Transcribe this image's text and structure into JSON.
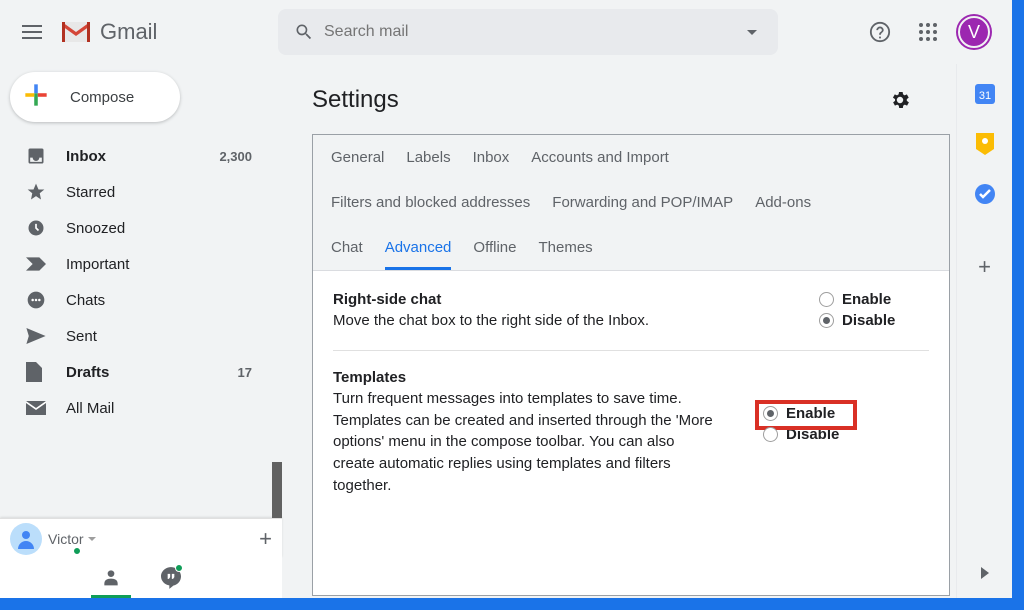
{
  "header": {
    "app_name": "Gmail",
    "search_placeholder": "Search mail",
    "avatar_letter": "V"
  },
  "compose": {
    "label": "Compose"
  },
  "sidebar": {
    "items": [
      {
        "label": "Inbox",
        "count": "2,300",
        "bold": true,
        "icon": "inbox"
      },
      {
        "label": "Starred",
        "icon": "star"
      },
      {
        "label": "Snoozed",
        "icon": "clock"
      },
      {
        "label": "Important",
        "icon": "important"
      },
      {
        "label": "Chats",
        "icon": "chat"
      },
      {
        "label": "Sent",
        "icon": "sent"
      },
      {
        "label": "Drafts",
        "count": "17",
        "bold": true,
        "icon": "draft"
      },
      {
        "label": "All Mail",
        "icon": "mail"
      }
    ]
  },
  "hangouts": {
    "user": "Victor"
  },
  "settings": {
    "title": "Settings",
    "tabs": [
      "General",
      "Labels",
      "Inbox",
      "Accounts and Import",
      "Filters and blocked addresses",
      "Forwarding and POP/IMAP",
      "Add-ons",
      "Chat",
      "Advanced",
      "Offline",
      "Themes"
    ],
    "active_tab": "Advanced",
    "rows": [
      {
        "title": "Right-side chat",
        "desc": "Move the chat box to the right side of the Inbox.",
        "options": {
          "enable": "Enable",
          "disable": "Disable"
        },
        "selected": "disable"
      },
      {
        "title": "Templates",
        "desc": "Turn frequent messages into templates to save time. Templates can be created and inserted through the 'More options' menu in the compose toolbar. You can also create automatic replies using templates and filters together.",
        "options": {
          "enable": "Enable",
          "disable": "Disable"
        },
        "selected": "enable",
        "highlight": true
      }
    ]
  }
}
